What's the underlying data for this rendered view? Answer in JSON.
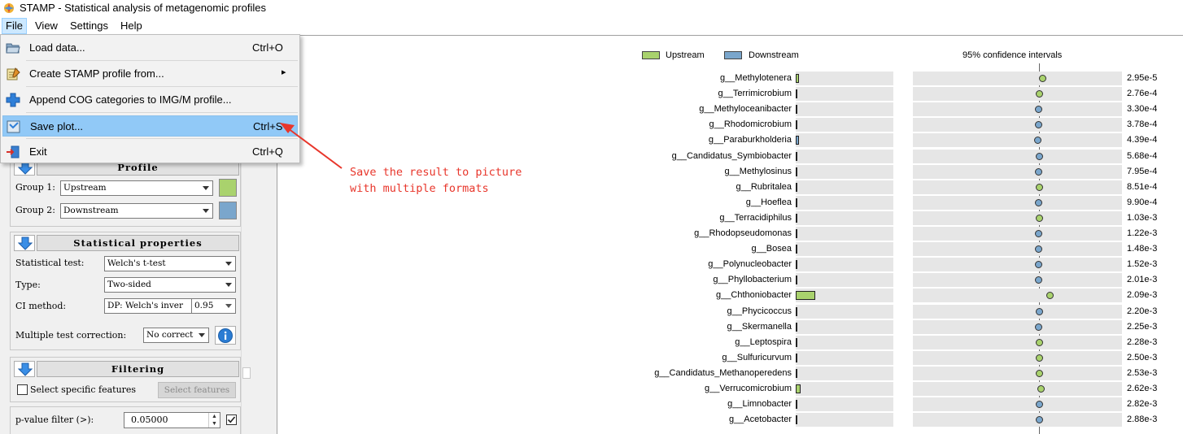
{
  "window": {
    "title": "STAMP - Statistical analysis of metagenomic profiles"
  },
  "menubar": [
    "File",
    "View",
    "Settings",
    "Help"
  ],
  "file_menu": {
    "items": [
      {
        "label": "Load data...",
        "shortcut": "Ctrl+O",
        "icon": "folder-open-icon"
      },
      {
        "label": "Create STAMP profile from...",
        "shortcut": "",
        "icon": "notepad-icon",
        "submenu": true
      },
      {
        "label": "Append COG categories to IMG/M profile...",
        "shortcut": "",
        "icon": "plus-icon"
      },
      {
        "label": "Save plot...",
        "shortcut": "Ctrl+S",
        "icon": "save-icon",
        "highlighted": true
      },
      {
        "label": "Exit",
        "shortcut": "Ctrl+Q",
        "icon": "exit-icon"
      }
    ],
    "submenu_arrow": "▸"
  },
  "annotation": {
    "text": "Save the result to picture\nwith multiple formats",
    "color": "#e8362b"
  },
  "profile": {
    "title": "Profile",
    "group1_label": "Group 1:",
    "group1_value": "Upstream",
    "group1_color": "#a9d26d",
    "group2_label": "Group 2:",
    "group2_value": "Downstream",
    "group2_color": "#7aa6cc"
  },
  "stats": {
    "title": "Statistical properties",
    "test_label": "Statistical test:",
    "test_value": "Welch's t-test",
    "type_label": "Type:",
    "type_value": "Two-sided",
    "ci_label": "CI method:",
    "ci_value": "DP: Welch's inver",
    "ci_level": "0.95",
    "mtc_label": "Multiple test correction:",
    "mtc_value": "No correct"
  },
  "filtering": {
    "title": "Filtering",
    "specific_label": "Select specific features",
    "select_btn": "Select features",
    "pvalue_label": "p-value filter (>):",
    "pvalue_value": "0.05000",
    "pvalue_checked": true
  },
  "plot": {
    "legend": [
      {
        "name": "Upstream",
        "color": "#a9d26d"
      },
      {
        "name": "Downstream",
        "color": "#7aa6cc"
      }
    ],
    "ci_title": "95% confidence intervals",
    "colors": {
      "up": "#a9d26d",
      "down": "#7aa6cc"
    },
    "rows": [
      {
        "feature": "g__Methylotenera",
        "p": "2.95e-5",
        "group": "up",
        "bar": 0.03,
        "ci": 0.62
      },
      {
        "feature": "g__Terrimicrobium",
        "p": "2.76e-4",
        "group": "up",
        "bar": 0.01,
        "ci": 0.605
      },
      {
        "feature": "g__Methyloceanibacter",
        "p": "3.30e-4",
        "group": "down",
        "bar": 0.01,
        "ci": 0.6
      },
      {
        "feature": "g__Rhodomicrobium",
        "p": "3.78e-4",
        "group": "down",
        "bar": 0.01,
        "ci": 0.6
      },
      {
        "feature": "g__Paraburkholderia",
        "p": "4.39e-4",
        "group": "down",
        "bar": 0.03,
        "ci": 0.595
      },
      {
        "feature": "g__Candidatus_Symbiobacter",
        "p": "5.68e-4",
        "group": "down",
        "bar": 0.005,
        "ci": 0.602
      },
      {
        "feature": "g__Methylosinus",
        "p": "7.95e-4",
        "group": "down",
        "bar": 0.005,
        "ci": 0.6
      },
      {
        "feature": "g__Rubritalea",
        "p": "8.51e-4",
        "group": "up",
        "bar": 0.005,
        "ci": 0.603
      },
      {
        "feature": "g__Hoeflea",
        "p": "9.90e-4",
        "group": "down",
        "bar": 0.005,
        "ci": 0.6
      },
      {
        "feature": "g__Terracidiphilus",
        "p": "1.03e-3",
        "group": "up",
        "bar": 0.005,
        "ci": 0.605
      },
      {
        "feature": "g__Rhodopseudomonas",
        "p": "1.22e-3",
        "group": "down",
        "bar": 0.005,
        "ci": 0.6
      },
      {
        "feature": "g__Bosea",
        "p": "1.48e-3",
        "group": "down",
        "bar": 0.01,
        "ci": 0.6
      },
      {
        "feature": "g__Polynucleobacter",
        "p": "1.52e-3",
        "group": "down",
        "bar": 0.01,
        "ci": 0.6
      },
      {
        "feature": "g__Phyllobacterium",
        "p": "2.01e-3",
        "group": "down",
        "bar": 0.005,
        "ci": 0.598
      },
      {
        "feature": "g__Chthoniobacter",
        "p": "2.09e-3",
        "group": "up",
        "bar": 0.2,
        "ci": 0.655
      },
      {
        "feature": "g__Phycicoccus",
        "p": "2.20e-3",
        "group": "down",
        "bar": 0.005,
        "ci": 0.602
      },
      {
        "feature": "g__Skermanella",
        "p": "2.25e-3",
        "group": "down",
        "bar": 0.01,
        "ci": 0.6
      },
      {
        "feature": "g__Leptospira",
        "p": "2.28e-3",
        "group": "up",
        "bar": 0.005,
        "ci": 0.603
      },
      {
        "feature": "g__Sulfuricurvum",
        "p": "2.50e-3",
        "group": "up",
        "bar": 0.005,
        "ci": 0.603
      },
      {
        "feature": "g__Candidatus_Methanoperedens",
        "p": "2.53e-3",
        "group": "up",
        "bar": 0.005,
        "ci": 0.603
      },
      {
        "feature": "g__Verrucomicrobium",
        "p": "2.62e-3",
        "group": "up",
        "bar": 0.05,
        "ci": 0.612
      },
      {
        "feature": "g__Limnobacter",
        "p": "2.82e-3",
        "group": "down",
        "bar": 0.005,
        "ci": 0.602
      },
      {
        "feature": "g__Acetobacter",
        "p": "2.88e-3",
        "group": "down",
        "bar": 0.005,
        "ci": 0.602
      }
    ]
  }
}
